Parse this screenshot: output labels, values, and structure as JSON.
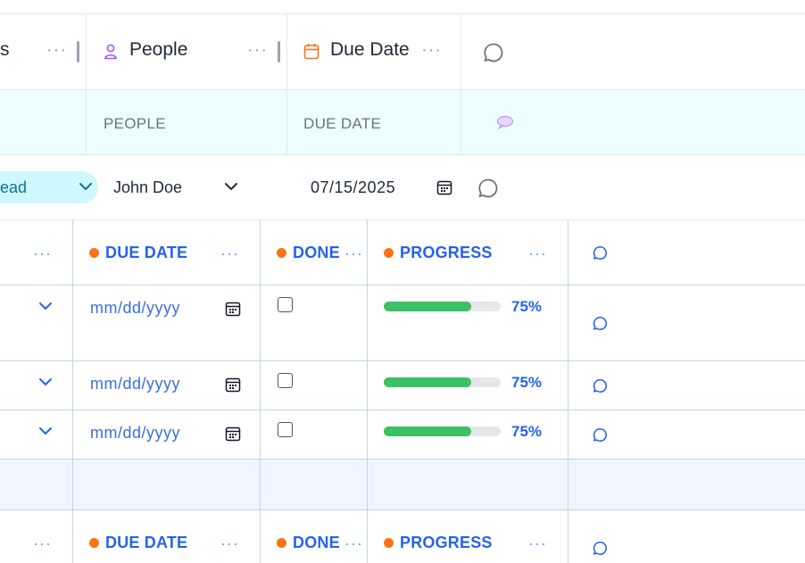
{
  "header": {
    "status_partial": "s",
    "people_title": "People",
    "due_date_title": "Due Date",
    "menu_dots": "···",
    "icons": {
      "people": "person-icon",
      "due_date": "calendar-icon",
      "comment": "comment-icon"
    }
  },
  "subheader": {
    "people_label": "PEOPLE",
    "due_date_label": "DUE DATE",
    "comment_icon": "speech-balloon-icon"
  },
  "row": {
    "status_value": "ead",
    "people_value": "John Doe",
    "due_date_value": "07/15/2025"
  },
  "subtable": {
    "columns": {
      "due_date": "DUE DATE",
      "done": "DONE",
      "progress": "PROGRESS",
      "menu_dots": "···"
    },
    "rows": [
      {
        "date_placeholder": "mm/dd/yyyy",
        "done": false,
        "progress": 0.75,
        "progress_label": "75%"
      },
      {
        "date_placeholder": "mm/dd/yyyy",
        "done": false,
        "progress": 0.75,
        "progress_label": "75%"
      },
      {
        "date_placeholder": "mm/dd/yyyy",
        "done": false,
        "progress": 0.75,
        "progress_label": "75%"
      }
    ],
    "footer_columns": {
      "due_date": "DUE DATE",
      "done": "DONE",
      "progress": "PROGRESS",
      "menu_dots": "···"
    }
  },
  "colors": {
    "accent_blue": "#2563eb",
    "status_orange": "#f97316",
    "progress_green": "#3cc165",
    "subheader_bg": "#ecfeff",
    "pill_bg": "#cff8fe"
  }
}
